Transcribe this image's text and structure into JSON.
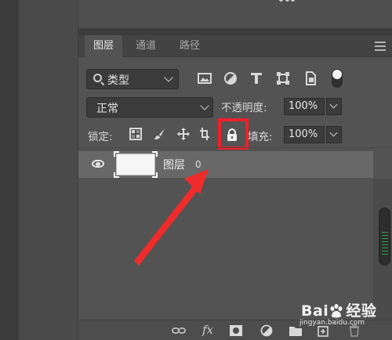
{
  "tabs": [
    {
      "label": "图层",
      "active": true
    },
    {
      "label": "通道",
      "active": false
    },
    {
      "label": "路径",
      "active": false
    }
  ],
  "filter": {
    "kind_label": "类型",
    "icons": [
      "image-filter-icon",
      "adjustment-filter-icon",
      "type-filter-icon",
      "shape-filter-icon",
      "smart-object-filter-icon",
      "filter-toggle-icon"
    ]
  },
  "blend": {
    "mode": "正常",
    "opacity_label": "不透明度:",
    "opacity_value": "100%"
  },
  "lock": {
    "label": "锁定:",
    "icons": [
      "lock-transparent-pixels-icon",
      "lock-image-pixels-icon",
      "lock-position-icon",
      "lock-artboard-icon",
      "lock-all-icon"
    ],
    "fill_label": "填充:",
    "fill_value": "100%",
    "highlight_color": "#f0202a"
  },
  "layers": [
    {
      "name": "图层",
      "number": "0",
      "visible": true
    }
  ],
  "bottom_icons": [
    "link-layers-icon",
    "layer-style-icon",
    "add-mask-icon",
    "adjustment-layer-icon",
    "new-group-icon",
    "new-layer-icon",
    "delete-layer-icon"
  ],
  "bottom_fx_label": "fx",
  "watermark": {
    "brand_left": "Bai",
    "brand_right": "经验",
    "url": "jingyan.baidu.com"
  },
  "arrow_color": "#ef2b2b"
}
